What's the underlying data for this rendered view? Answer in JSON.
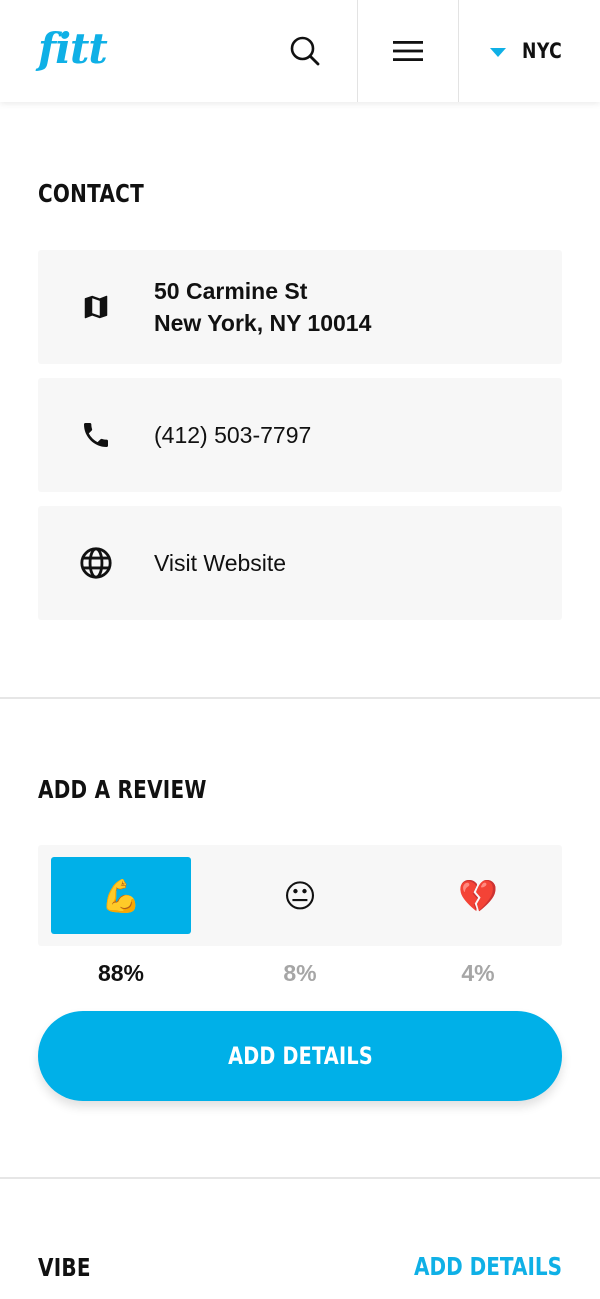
{
  "header": {
    "logo": "fitt",
    "search_icon": "search-icon",
    "menu_icon": "hamburger-menu-icon",
    "city": "NYC",
    "accent": "#0fb0e6"
  },
  "contact": {
    "title": "CONTACT",
    "address_line1": "50 Carmine St",
    "address_line2": "New York, NY 10014",
    "phone": "(412) 503-7797",
    "website": "Visit Website",
    "icons": [
      "map-icon",
      "phone-icon",
      "globe-icon"
    ]
  },
  "review": {
    "title": "ADD A REVIEW",
    "options": [
      {
        "emoji": "💪",
        "percent": "88%",
        "selected": true
      },
      {
        "emoji": "😐",
        "percent": "8%",
        "selected": false
      },
      {
        "emoji": "💔",
        "percent": "4%",
        "selected": false
      }
    ],
    "button_label": "ADD DETAILS",
    "button_color": "#00b0e8"
  },
  "vibe": {
    "title": "VIBE",
    "link_label": "ADD DETAILS"
  }
}
